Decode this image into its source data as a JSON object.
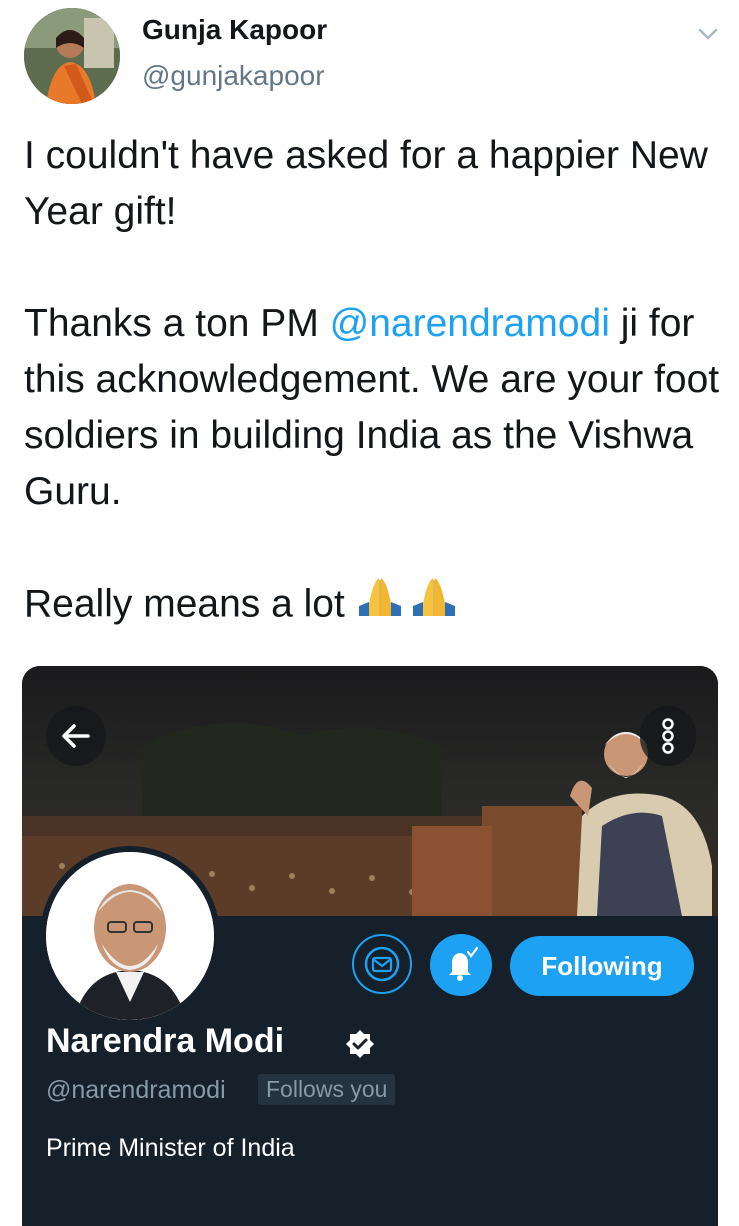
{
  "tweet": {
    "author_name": "Gunja Kapoor",
    "author_handle": "@gunjakapoor",
    "text_line1": "I couldn't have asked for a happier New Year gift!",
    "text_line2_pre": "Thanks a ton PM ",
    "text_line2_mention": "@narendramodi",
    "text_line2_post": " ji for this acknowledgement. We are your foot soldiers in building India as the Vishwa Guru.",
    "text_line3": "Really means a lot",
    "emoji": "folded-hands x2"
  },
  "profile_card": {
    "name": "Narendra Modi",
    "handle": "@narendramodi",
    "follows_you": "Follows you",
    "bio": "Prime Minister of India",
    "following_label": "Following"
  },
  "colors": {
    "accent": "#1da1f2",
    "card_bg": "#15202b",
    "muted": "#657786"
  },
  "icons": [
    "chevron-down-icon",
    "back-arrow-icon",
    "more-icon",
    "mail-icon",
    "bell-icon",
    "verified-icon"
  ]
}
